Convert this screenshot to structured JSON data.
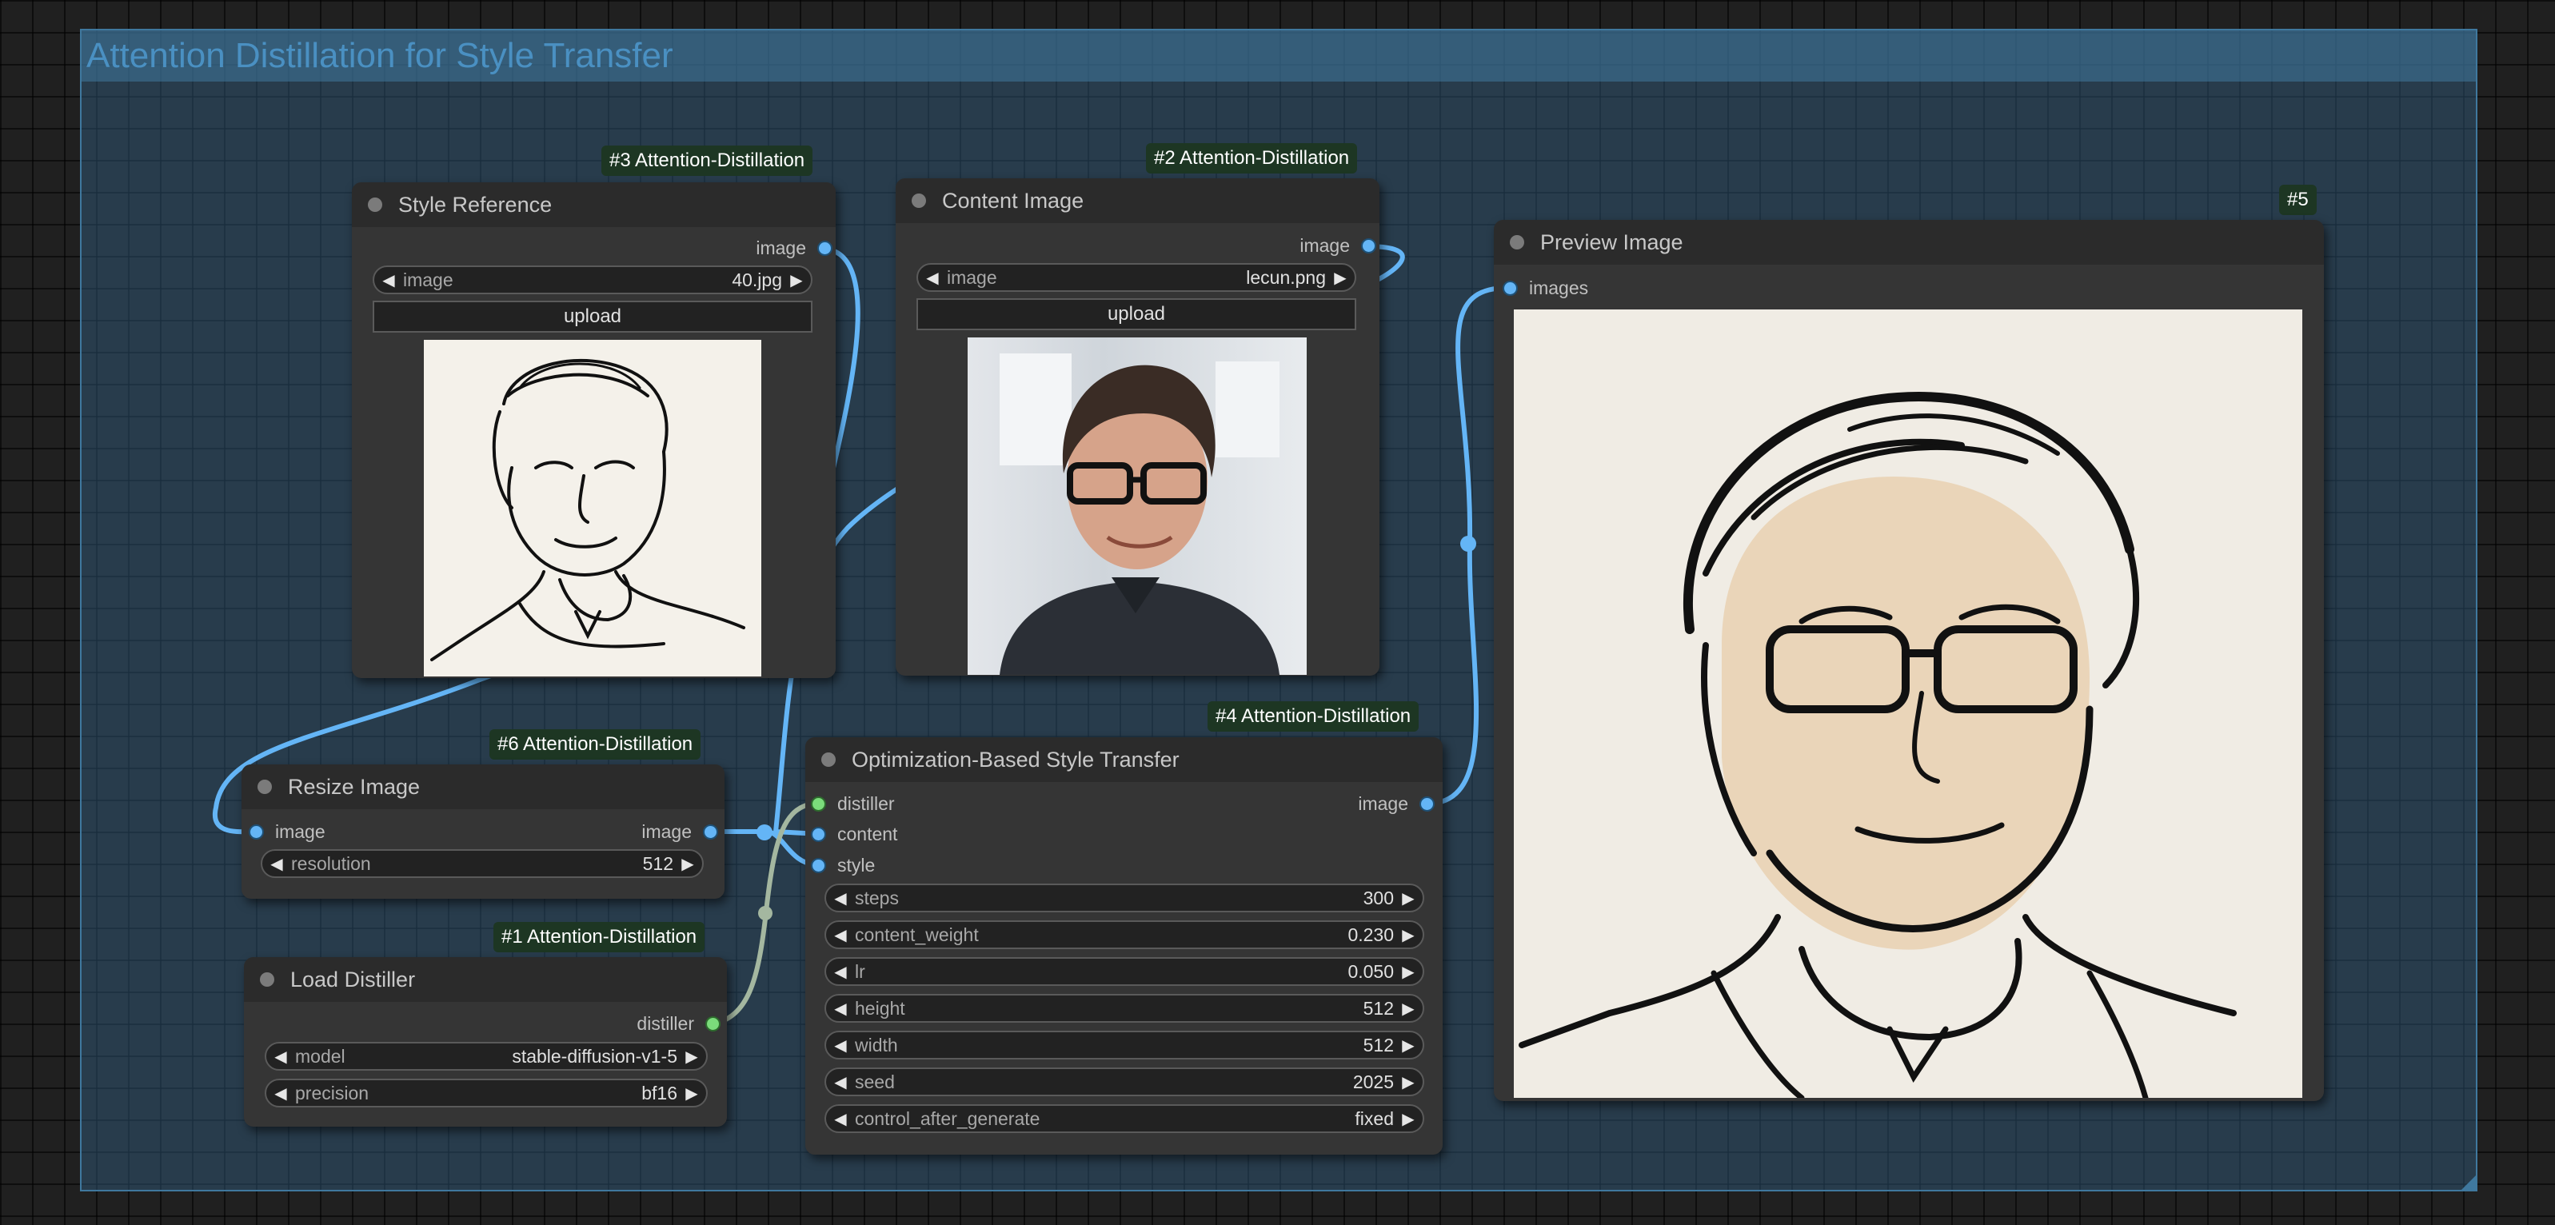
{
  "group": {
    "title": "Attention Distillation for Style Transfer"
  },
  "nodes": {
    "style_reference": {
      "badge": "#3 Attention-Distillation",
      "title": "Style Reference",
      "output": "image",
      "widget": {
        "label": "image",
        "value": "40.jpg"
      },
      "upload_label": "upload",
      "image_alt": "line drawing portrait"
    },
    "content_image": {
      "badge": "#2 Attention-Distillation",
      "title": "Content Image",
      "output": "image",
      "widget": {
        "label": "image",
        "value": "lecun.png"
      },
      "upload_label": "upload"
    },
    "preview_image": {
      "badge": "#5",
      "title": "Preview Image",
      "input": "images"
    },
    "resize_image": {
      "badge": "#6 Attention-Distillation",
      "title": "Resize Image",
      "input": "image",
      "output": "image",
      "widget": {
        "label": "resolution",
        "value": "512"
      }
    },
    "load_distiller": {
      "badge": "#1 Attention-Distillation",
      "title": "Load Distiller",
      "output": "distiller",
      "widgets": [
        {
          "label": "model",
          "value": "stable-diffusion-v1-5"
        },
        {
          "label": "precision",
          "value": "bf16"
        }
      ]
    },
    "style_transfer": {
      "badge": "#4 Attention-Distillation",
      "title": "Optimization-Based Style Transfer",
      "inputs": [
        "distiller",
        "content",
        "style"
      ],
      "output": "image",
      "widgets": [
        {
          "label": "steps",
          "value": "300"
        },
        {
          "label": "content_weight",
          "value": "0.230"
        },
        {
          "label": "lr",
          "value": "0.050"
        },
        {
          "label": "height",
          "value": "512"
        },
        {
          "label": "width",
          "value": "512"
        },
        {
          "label": "seed",
          "value": "2025"
        },
        {
          "label": "control_after_generate",
          "value": "fixed"
        }
      ]
    }
  },
  "colors": {
    "link_image": "#64b5f6",
    "link_distiller": "#a4b7a0",
    "group_fill": "#336083",
    "badge_bg": "#1d3623"
  },
  "icons": {
    "left": "◀",
    "right": "▶"
  }
}
